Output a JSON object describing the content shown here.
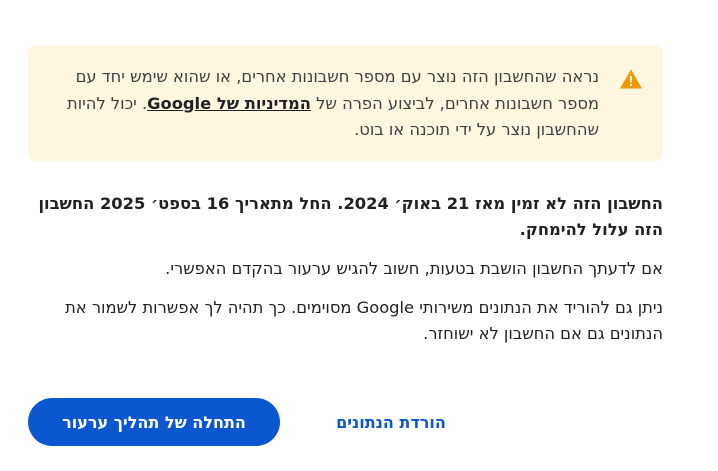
{
  "warning": {
    "icon": "warning-triangle-icon",
    "icon_color": "#f29900",
    "text_part1": "נראה שהחשבון הזה נוצר עם מספר חשבונות אחרים, או שהוא שימש יחד עם מספר חשבונות אחרים, לביצוע הפרה של ",
    "policy_link": "המדיניות של Google",
    "text_part2": ". יכול להיות שהחשבון נוצר על ידי תוכנה או בוט."
  },
  "main": {
    "disabled_notice": "החשבון הזה לא זמין מאז 21 באוק׳ 2024. החל מתאריך 16 בספט׳ 2025 החשבון הזה עלול להימחק.",
    "appeal_notice": "אם לדעתך החשבון הושבת בטעות, חשוב להגיש ערעור בהקדם האפשרי.",
    "download_notice": "ניתן גם להוריד את הנתונים משירותי Google מסוימים. כך תהיה לך אפשרות לשמור את הנתונים גם אם החשבון לא ישוחזר."
  },
  "actions": {
    "start_appeal_label": "התחלה של תהליך ערעור",
    "download_data_label": "הורדת הנתונים"
  },
  "colors": {
    "primary": "#0b57d0",
    "warning_bg": "#fef7e0"
  }
}
